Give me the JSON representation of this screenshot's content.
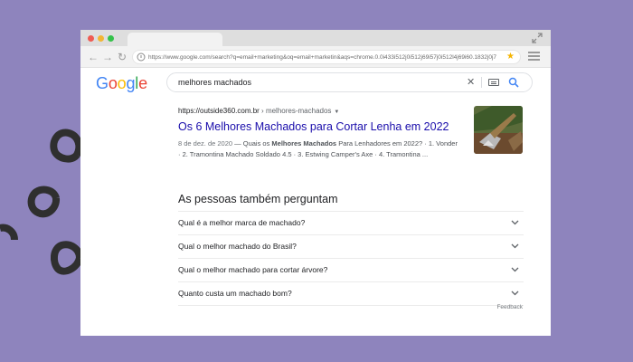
{
  "browser": {
    "url": "https://www.google.com/search?q=email+marketing&oq=email+marketin&aqs=chrome.0.0i433i512j0i512j69i57j0i512l4j69i60.1832j0j7&sourceid..."
  },
  "google": {
    "logo": [
      "G",
      "o",
      "o",
      "g",
      "l",
      "e"
    ],
    "query": "melhores machados"
  },
  "result": {
    "domain": "https://outside360.com.br",
    "path": " › melhores-machados",
    "title": "Os 6 Melhores Machados para Cortar Lenha em 2022",
    "date": "8 de dez. de 2020",
    "snippet_pre": " — Quais os ",
    "snippet_bold": "Melhores Machados",
    "snippet_post": " Para Lenhadores em 2022? · 1. Vonder · 2. Tramontina Machado Soldado 4.5 · 3. Estwing Camper's Axe · 4. Tramontina ..."
  },
  "people_also_ask": {
    "heading": "As pessoas também perguntam",
    "questions": [
      "Qual é a melhor marca de machado?",
      "Qual o melhor machado do Brasil?",
      "Qual o melhor machado para cortar árvore?",
      "Quanto custa um machado bom?"
    ],
    "feedback": "Feedback"
  },
  "colors": {
    "background": "#8e84bd",
    "link": "#1a0dab",
    "decor": "#2f2f2f"
  }
}
